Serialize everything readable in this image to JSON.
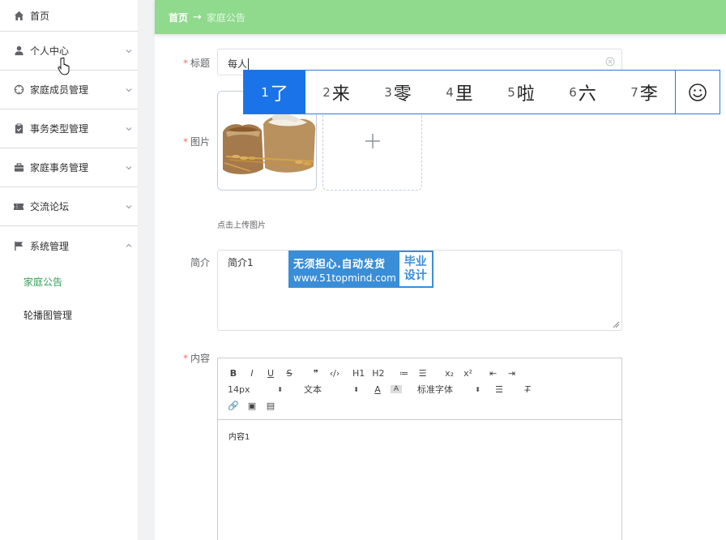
{
  "sidebar": {
    "items": [
      {
        "label": "首页",
        "icon": "home-icon"
      },
      {
        "label": "个人中心",
        "icon": "user-icon"
      },
      {
        "label": "家庭成员管理",
        "icon": "crosshair-icon"
      },
      {
        "label": "事务类型管理",
        "icon": "clipboard-icon"
      },
      {
        "label": "家庭事务管理",
        "icon": "briefcase-icon"
      },
      {
        "label": "交流论坛",
        "icon": "ticket-icon"
      },
      {
        "label": "系统管理",
        "icon": "flag-icon"
      }
    ],
    "sub_items": [
      {
        "label": "家庭公告",
        "active": true
      },
      {
        "label": "轮播图管理",
        "active": false
      }
    ]
  },
  "header": {
    "home": "首页",
    "separator": "→",
    "current": "家庭公告"
  },
  "form": {
    "title_label": "标题",
    "title_value": "每人",
    "image_label": "图片",
    "upload_hint": "点击上传图片",
    "intro_label": "简介",
    "intro_value": "简介1",
    "content_label": "内容",
    "content_value": "内容1"
  },
  "ime": {
    "candidates": [
      {
        "num": "1",
        "char": "了"
      },
      {
        "num": "2",
        "char": "来"
      },
      {
        "num": "3",
        "char": "零"
      },
      {
        "num": "4",
        "char": "里"
      },
      {
        "num": "5",
        "char": "啦"
      },
      {
        "num": "6",
        "char": "六"
      },
      {
        "num": "7",
        "char": "李"
      }
    ]
  },
  "watermark": {
    "line1": "无须担心.自动发货",
    "line2": "www.51topmind.com",
    "right1": "毕业",
    "right2": "设计"
  },
  "editor": {
    "row1": [
      "B",
      "I",
      "U",
      "S",
      "❞",
      "‹/›",
      "H1",
      "H2",
      "≔",
      "☰",
      "x₂",
      "x²",
      "⇤",
      "⇥"
    ],
    "font_size": "14px",
    "block_type": "文本",
    "font_family": "标准字体"
  },
  "colors": {
    "header_bg": "#8fda8d",
    "active_menu": "#37a05a",
    "ime_selected": "#1a73e8",
    "required": "#f56c6c"
  }
}
